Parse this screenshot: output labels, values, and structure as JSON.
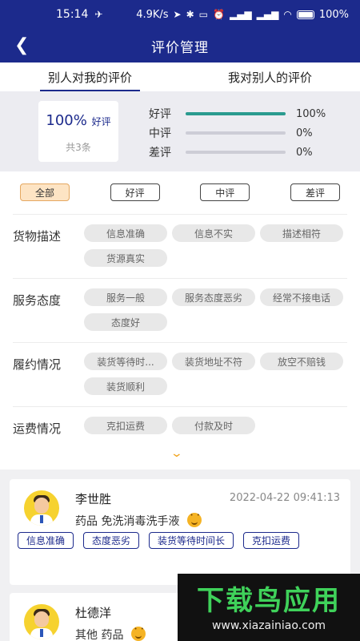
{
  "status_bar": {
    "time": "15:14",
    "speed": "4.9K/s",
    "battery": "100%"
  },
  "nav": {
    "back_icon": "chevron-left-icon",
    "title": "评价管理"
  },
  "tabs": [
    {
      "label": "别人对我的评价",
      "active": true
    },
    {
      "label": "我对别人的评价",
      "active": false
    }
  ],
  "summary": {
    "score": "100%",
    "score_label": "好评",
    "total": "共3条",
    "bars": [
      {
        "label": "好评",
        "percent": "100%",
        "value": 1.0
      },
      {
        "label": "中评",
        "percent": "0%",
        "value": 0.0
      },
      {
        "label": "差评",
        "percent": "0%",
        "value": 0.0
      }
    ],
    "bar_color": "#2a9b8f"
  },
  "filters": [
    {
      "label": "全部",
      "active": true
    },
    {
      "label": "好评",
      "active": false
    },
    {
      "label": "中评",
      "active": false
    },
    {
      "label": "差评",
      "active": false
    }
  ],
  "categories": [
    {
      "title": "货物描述",
      "tags": [
        "信息准确",
        "信息不实",
        "描述相符",
        "货源真实"
      ]
    },
    {
      "title": "服务态度",
      "tags": [
        "服务一般",
        "服务态度恶劣",
        "经常不接电话",
        "态度好"
      ]
    },
    {
      "title": "履约情况",
      "tags": [
        "装货等待时...",
        "装货地址不符",
        "放空不赔钱",
        "装货顺利"
      ]
    },
    {
      "title": "运费情况",
      "tags": [
        "克扣运费",
        "付款及时"
      ]
    }
  ],
  "reviews": [
    {
      "name": "李世胜",
      "date": "2022-04-22 09:41:13",
      "goods": "药品 免洗消毒洗手液",
      "tags": [
        "信息准确",
        "态度恶劣",
        "装货等待时间长",
        "克扣运费"
      ]
    },
    {
      "name": "杜德洋",
      "date": "",
      "goods": "其他 药品",
      "tags": []
    }
  ],
  "watermark": {
    "main": "下载鸟应用",
    "sub": "www.xiazainiao.com"
  },
  "accent": "#1c2a8c"
}
